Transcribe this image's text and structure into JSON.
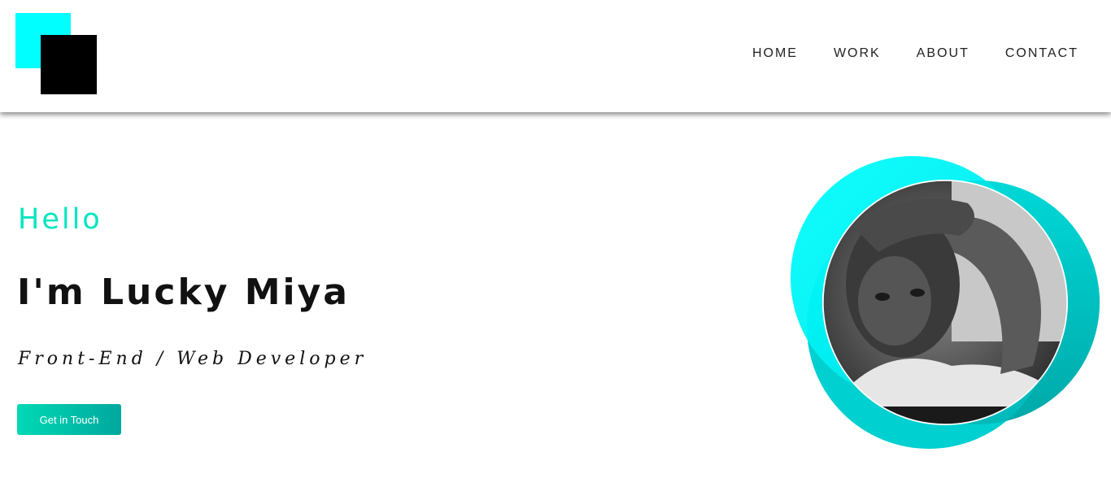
{
  "nav": {
    "items": [
      {
        "label": "HOME"
      },
      {
        "label": "WORK"
      },
      {
        "label": "ABOUT"
      },
      {
        "label": "CONTACT"
      }
    ]
  },
  "hero": {
    "greeting": "Hello",
    "name": "I'm Lucky Miya",
    "role": "Front-End / Web Developer",
    "cta_label": "Get in Touch"
  },
  "colors": {
    "accent_cyan": "#00ffff",
    "accent_teal": "#00e5c0",
    "logo_black": "#000000",
    "button_gradient_start": "#00d9b4",
    "button_gradient_end": "#00a89e"
  },
  "icons": {
    "logo": "overlapping-squares-logo",
    "portrait": "profile-photo"
  }
}
